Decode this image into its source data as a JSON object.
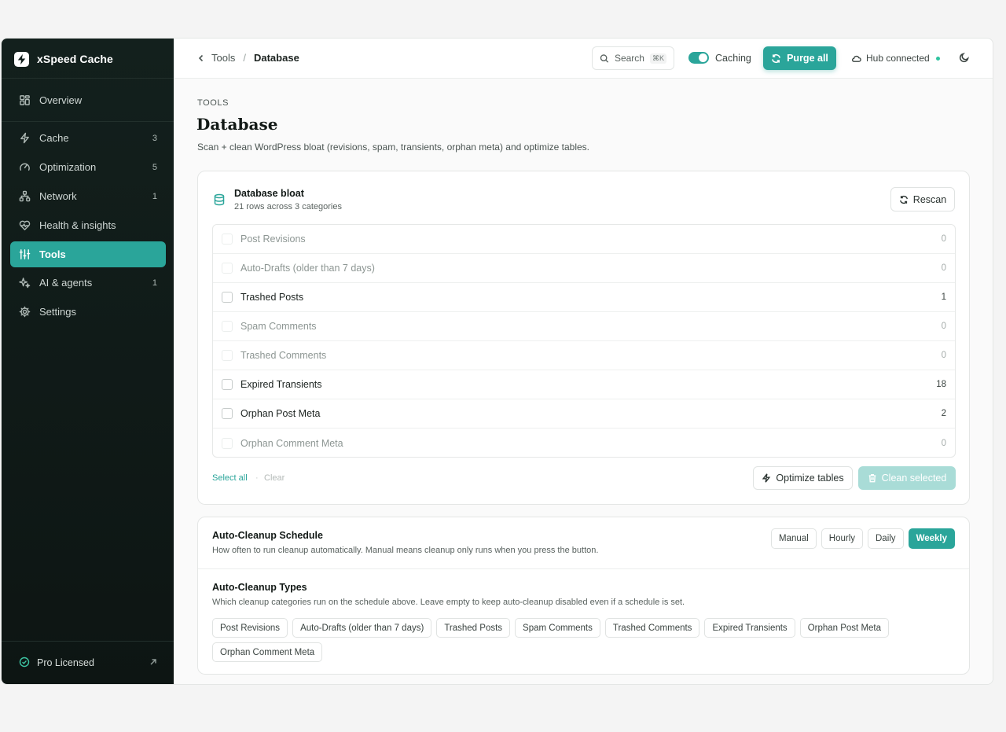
{
  "brand": {
    "name": "xSpeed Cache"
  },
  "sidebar": {
    "items": [
      {
        "label": "Overview",
        "count": "",
        "icon": "grid-icon"
      },
      {
        "label": "Cache",
        "count": "3",
        "icon": "bolt-icon"
      },
      {
        "label": "Optimization",
        "count": "5",
        "icon": "gauge-icon"
      },
      {
        "label": "Network",
        "count": "1",
        "icon": "network-icon"
      },
      {
        "label": "Health & insights",
        "count": "",
        "icon": "heart-pulse-icon"
      },
      {
        "label": "Tools",
        "count": "",
        "icon": "sliders-icon",
        "active": true
      },
      {
        "label": "AI & agents",
        "count": "1",
        "icon": "sparkles-icon"
      },
      {
        "label": "Settings",
        "count": "",
        "icon": "gear-icon"
      }
    ],
    "footer": {
      "label": "Pro Licensed"
    }
  },
  "topbar": {
    "breadcrumb": {
      "back": "Tools",
      "sep": "/",
      "current": "Database"
    },
    "search": {
      "label": "Search",
      "shortcut": "⌘K"
    },
    "caching": {
      "label": "Caching",
      "on": true
    },
    "purge_label": "Purge all",
    "hub_label": "Hub connected"
  },
  "page": {
    "eyebrow": "TOOLS",
    "title": "Database",
    "subtitle": "Scan + clean WordPress bloat (revisions, spam, transients, orphan meta) and optimize tables."
  },
  "bloat": {
    "title": "Database bloat",
    "subtitle": "21 rows across 3 categories",
    "rescan_label": "Rescan",
    "rows": [
      {
        "label": "Post Revisions",
        "count": "0",
        "enabled": false
      },
      {
        "label": "Auto-Drafts (older than 7 days)",
        "count": "0",
        "enabled": false
      },
      {
        "label": "Trashed Posts",
        "count": "1",
        "enabled": true
      },
      {
        "label": "Spam Comments",
        "count": "0",
        "enabled": false
      },
      {
        "label": "Trashed Comments",
        "count": "0",
        "enabled": false
      },
      {
        "label": "Expired Transients",
        "count": "18",
        "enabled": true
      },
      {
        "label": "Orphan Post Meta",
        "count": "2",
        "enabled": true
      },
      {
        "label": "Orphan Comment Meta",
        "count": "0",
        "enabled": false
      }
    ],
    "select_all": "Select all",
    "dot": "·",
    "clear": "Clear",
    "optimize_label": "Optimize tables",
    "clean_label": "Clean selected"
  },
  "schedule": {
    "title": "Auto-Cleanup Schedule",
    "subtitle": "How often to run cleanup automatically. Manual means cleanup only runs when you press the button.",
    "options": [
      "Manual",
      "Hourly",
      "Daily",
      "Weekly"
    ],
    "selected": "Weekly"
  },
  "types": {
    "title": "Auto-Cleanup Types",
    "subtitle": "Which cleanup categories run on the schedule above. Leave empty to keep auto-cleanup disabled even if a schedule is set.",
    "chips": [
      "Post Revisions",
      "Auto-Drafts (older than 7 days)",
      "Trashed Posts",
      "Spam Comments",
      "Trashed Comments",
      "Expired Transients",
      "Orphan Post Meta",
      "Orphan Comment Meta"
    ]
  },
  "colors": {
    "accent": "#2aa59a",
    "sidebar_bg": "#13201d",
    "status_dot": "#2fc4a0"
  }
}
